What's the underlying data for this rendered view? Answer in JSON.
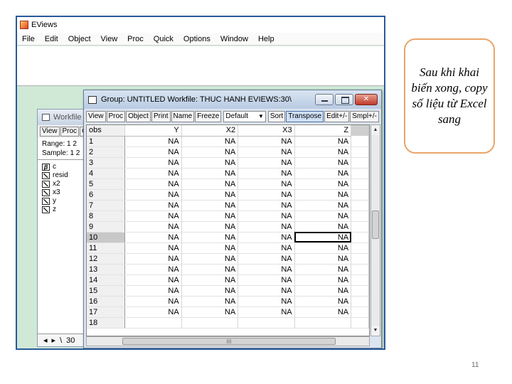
{
  "app": {
    "title": "EViews",
    "menu": [
      "File",
      "Edit",
      "Object",
      "View",
      "Proc",
      "Quick",
      "Options",
      "Window",
      "Help"
    ]
  },
  "workfile": {
    "title": "Workfile",
    "toolbar": [
      "View",
      "Proc",
      "O"
    ],
    "range_line": "Range:  1 2",
    "sample_line": "Sample: 1 2",
    "objects": [
      {
        "name": "c",
        "icon": "coef-icon"
      },
      {
        "name": "resid",
        "icon": "series-icon"
      },
      {
        "name": "x2",
        "icon": "series-icon"
      },
      {
        "name": "x3",
        "icon": "series-icon"
      },
      {
        "name": "y",
        "icon": "series-icon"
      },
      {
        "name": "z",
        "icon": "series-icon"
      }
    ],
    "tab_label": "30"
  },
  "group": {
    "title": "Group: UNTITLED   Workfile: THUC HANH EVIEWS:30\\",
    "toolbar": {
      "view": "View",
      "proc": "Proc",
      "object": "Object",
      "print": "Print",
      "name": "Name",
      "freeze": "Freeze",
      "display": "Default",
      "sort": "Sort",
      "transpose": "Transpose",
      "edit": "Edit+/-",
      "smpl": "Smpl+/-"
    },
    "columns": [
      "obs",
      "Y",
      "X2",
      "X3",
      "Z"
    ],
    "rows": [
      {
        "obs": "1",
        "y": "NA",
        "x2": "NA",
        "x3": "NA",
        "z": "NA"
      },
      {
        "obs": "2",
        "y": "NA",
        "x2": "NA",
        "x3": "NA",
        "z": "NA"
      },
      {
        "obs": "3",
        "y": "NA",
        "x2": "NA",
        "x3": "NA",
        "z": "NA"
      },
      {
        "obs": "4",
        "y": "NA",
        "x2": "NA",
        "x3": "NA",
        "z": "NA"
      },
      {
        "obs": "5",
        "y": "NA",
        "x2": "NA",
        "x3": "NA",
        "z": "NA"
      },
      {
        "obs": "6",
        "y": "NA",
        "x2": "NA",
        "x3": "NA",
        "z": "NA"
      },
      {
        "obs": "7",
        "y": "NA",
        "x2": "NA",
        "x3": "NA",
        "z": "NA"
      },
      {
        "obs": "8",
        "y": "NA",
        "x2": "NA",
        "x3": "NA",
        "z": "NA"
      },
      {
        "obs": "9",
        "y": "NA",
        "x2": "NA",
        "x3": "NA",
        "z": "NA"
      },
      {
        "obs": "10",
        "y": "NA",
        "x2": "NA",
        "x3": "NA",
        "z": "NA"
      },
      {
        "obs": "11",
        "y": "NA",
        "x2": "NA",
        "x3": "NA",
        "z": "NA"
      },
      {
        "obs": "12",
        "y": "NA",
        "x2": "NA",
        "x3": "NA",
        "z": "NA"
      },
      {
        "obs": "13",
        "y": "NA",
        "x2": "NA",
        "x3": "NA",
        "z": "NA"
      },
      {
        "obs": "14",
        "y": "NA",
        "x2": "NA",
        "x3": "NA",
        "z": "NA"
      },
      {
        "obs": "15",
        "y": "NA",
        "x2": "NA",
        "x3": "NA",
        "z": "NA"
      },
      {
        "obs": "16",
        "y": "NA",
        "x2": "NA",
        "x3": "NA",
        "z": "NA"
      },
      {
        "obs": "17",
        "y": "NA",
        "x2": "NA",
        "x3": "NA",
        "z": "NA"
      },
      {
        "obs": "18",
        "y": "",
        "x2": "",
        "x3": "",
        "z": ""
      }
    ],
    "selected_obs": "10",
    "hscroll_label": "III"
  },
  "callout": {
    "text": "Sau khi khai biến xong, copy số liệu từ Excel sang"
  },
  "slide_number": "11",
  "colors": {
    "accent_border": "#2a5a9a",
    "callout_border": "#e8a66a",
    "workspace_bg": "#cfe9d6"
  }
}
